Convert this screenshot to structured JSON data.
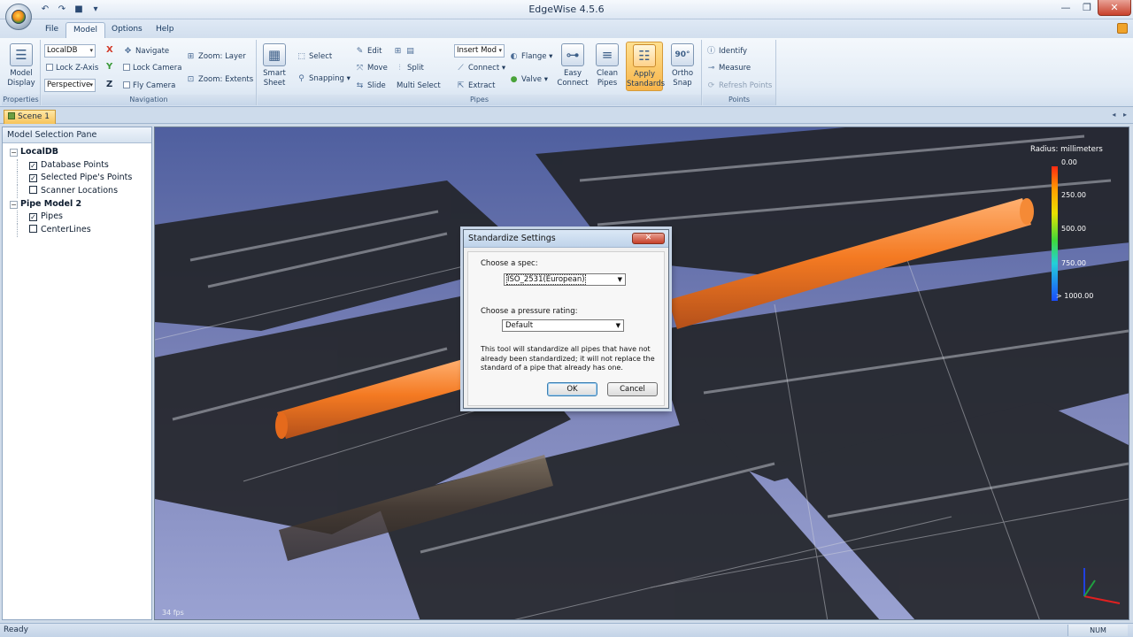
{
  "window": {
    "title": "EdgeWise 4.5.6",
    "controls": {
      "minimize": "—",
      "maximize": "❐",
      "close": "✕"
    }
  },
  "quick_access": {
    "undo_icon": "↶",
    "redo_icon": "↷",
    "save_icon": "■",
    "more_icon": "▾"
  },
  "menu": {
    "tabs": [
      {
        "label": "File"
      },
      {
        "label": "Model"
      },
      {
        "label": "Options"
      },
      {
        "label": "Help"
      }
    ],
    "active": "Model"
  },
  "ribbon": {
    "properties": {
      "label": "Properties",
      "model_display": "Model\nDisplay"
    },
    "navigation": {
      "label": "Navigation",
      "db_select": "LocalDB",
      "lock_z_axis": "Lock Z-Axis",
      "view_select": "Perspective",
      "axis_x": "X",
      "axis_y": "Y",
      "axis_z": "Z",
      "navigate": "Navigate",
      "lock_camera": "Lock Camera",
      "fly_camera": "Fly Camera",
      "zoom_layer": "Zoom: Layer",
      "zoom_extents": "Zoom: Extents"
    },
    "pipes": {
      "label": "Pipes",
      "smart_sheet": "Smart\nSheet",
      "select": "Select",
      "snapping": "Snapping",
      "edit": "Edit",
      "move": "Move",
      "split": "Split",
      "slide": "Slide",
      "multi_select": "Multi Select",
      "insert_mode": "Insert Mod",
      "connect": "Connect",
      "extract": "Extract",
      "flange": "Flange",
      "valve": "Valve",
      "easy_connect": "Easy\nConnect",
      "clean_pipes": "Clean\nPipes",
      "apply_standards": "Apply\nStandards",
      "ortho_snap": "Ortho\nSnap",
      "ortho_badge": "90°"
    },
    "points": {
      "label": "Points",
      "identify": "Identify",
      "measure": "Measure",
      "refresh_points": "Refresh Points"
    }
  },
  "scene": {
    "tab": "Scene 1",
    "scroll_arrows": "◂ ▸"
  },
  "pane": {
    "title": "Model Selection Pane",
    "tree": [
      {
        "label": "LocalDB",
        "level": 0,
        "expander": "−"
      },
      {
        "label": "Database Points",
        "level": 1,
        "checked": true
      },
      {
        "label": "Selected Pipe's Points",
        "level": 1,
        "checked": true
      },
      {
        "label": "Scanner Locations",
        "level": 1,
        "checked": false
      },
      {
        "label": "Pipe Model 2",
        "level": 0,
        "expander": "−"
      },
      {
        "label": "Pipes",
        "level": 1,
        "checked": true
      },
      {
        "label": "CenterLines",
        "level": 1,
        "checked": false
      }
    ]
  },
  "viewport": {
    "fps": "34 fps",
    "legend": {
      "title": "Radius: millimeters",
      "labels": [
        "0.00",
        "250.00",
        "500.00",
        "750.00",
        "> 1000.00"
      ]
    },
    "colors": {
      "pipe": "#f07a28",
      "sky": "#8a93c4",
      "points": "#1b1b1b"
    }
  },
  "dialog": {
    "title": "Standardize Settings",
    "close": "✕",
    "spec_label": "Choose a spec:",
    "spec_value": "ISO_2531(European)",
    "rating_label": "Choose a pressure rating:",
    "rating_value": "Default",
    "description": "This tool will standardize all pipes that have not already been standardized; it will not replace the standard of a pipe that already has one.",
    "ok": "OK",
    "cancel": "Cancel"
  },
  "status": {
    "text": "Ready",
    "num": "NUM"
  }
}
